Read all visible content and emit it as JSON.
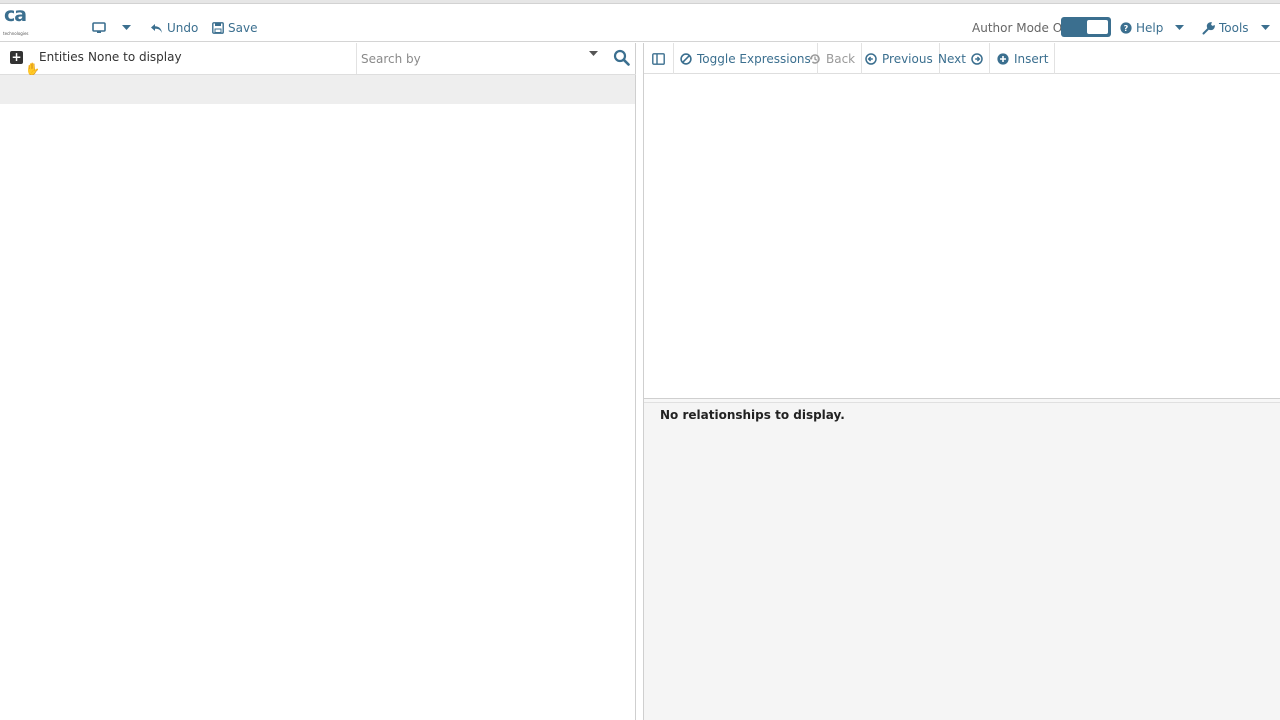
{
  "logo": {
    "text": "ca",
    "subtext": "technologies"
  },
  "toolbar": {
    "undo_label": "Undo",
    "save_label": "Save",
    "author_mode_label": "Author Mode On",
    "help_label": "Help",
    "tools_label": "Tools"
  },
  "entities": {
    "label": "Entities",
    "status": "None to display",
    "search_placeholder": "Search by"
  },
  "graph_toolbar": {
    "toggle_expressions": "Toggle Expressions",
    "back": "Back",
    "previous": "Previous",
    "next": "Next",
    "insert": "Insert"
  },
  "relationships": {
    "empty_text": "No relationships to display."
  },
  "colors": {
    "accent": "#3b6f8f",
    "panel_bg": "#f5f5f5"
  }
}
